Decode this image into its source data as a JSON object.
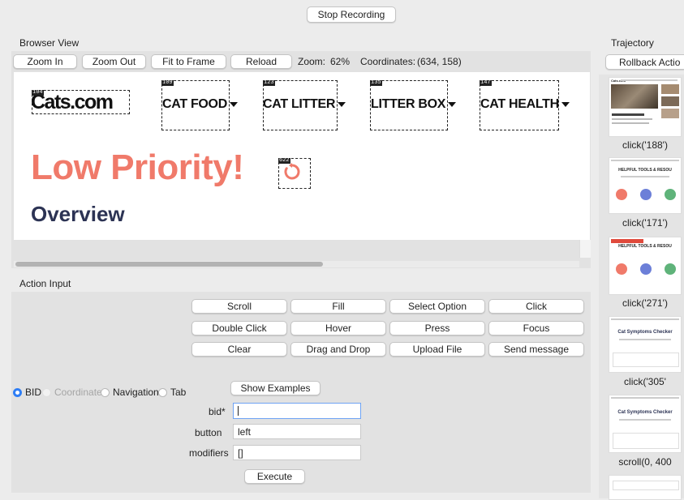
{
  "toolbar": {
    "stop_recording": "Stop Recording"
  },
  "browser_view": {
    "title": "Browser View",
    "zoom_in": "Zoom In",
    "zoom_out": "Zoom Out",
    "fit_to_frame": "Fit to Frame",
    "reload": "Reload",
    "zoom_label": "Zoom:",
    "zoom_value": "62%",
    "coords_label": "Coordinates:",
    "coords_value": "(634, 158)",
    "page": {
      "logo": "Cats.com",
      "logo_bid": "104",
      "nav": [
        {
          "label": "CAT FOOD",
          "bid": "109"
        },
        {
          "label": "CAT LITTER",
          "bid": "123"
        },
        {
          "label": "LITTER BOX",
          "bid": "135"
        },
        {
          "label": "CAT HEALTH",
          "bid": "147"
        }
      ],
      "headline": "Low Priority!",
      "spinner_bid": "622",
      "subheadline": "Overview"
    }
  },
  "action_input": {
    "title": "Action Input",
    "actions": [
      "Scroll",
      "Fill",
      "Select Option",
      "Click",
      "Double Click",
      "Hover",
      "Press",
      "Focus",
      "Clear",
      "Drag and Drop",
      "Upload File",
      "Send message"
    ],
    "modes": [
      "BID",
      "Coordinate",
      "Navigation",
      "Tab"
    ],
    "selected_mode": "BID",
    "show_examples": "Show Examples",
    "fields": [
      {
        "label": "bid*",
        "value": ""
      },
      {
        "label": "button",
        "value": "left"
      },
      {
        "label": "modifiers",
        "value": "[]"
      }
    ],
    "execute": "Execute"
  },
  "trajectory": {
    "title": "Trajectory",
    "rollback": "Rollback Actio",
    "steps": [
      {
        "caption": "click('188')"
      },
      {
        "caption": "click('171')"
      },
      {
        "caption": "click('271')"
      },
      {
        "caption": "click('305'"
      },
      {
        "caption": "scroll(0, 400"
      }
    ],
    "thumb_texts": {
      "logo": "Cats.com",
      "helpful": "HELPFUL TOOLS & RESOU",
      "checker": "Cat Symptoms Checker"
    }
  },
  "colors": {
    "accent": "#2f7ef5",
    "headline": "#f07a6a",
    "subheadline": "#2c3354",
    "logo": "#111111"
  }
}
